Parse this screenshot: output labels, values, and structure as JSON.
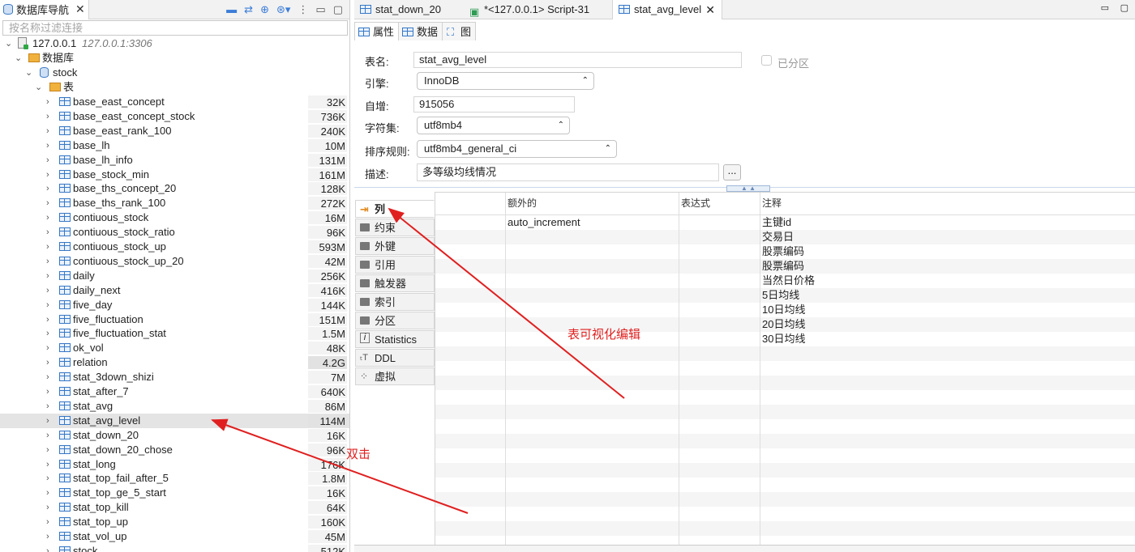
{
  "navigator": {
    "tab_title": "数据库导航",
    "filter_placeholder": "按名称过滤连接",
    "connection": {
      "name": "127.0.0.1",
      "address": "127.0.0.1:3306"
    },
    "databases_folder": "数据库",
    "schema": "stock",
    "tables_folder": "表",
    "tables": [
      {
        "name": "base_east_concept",
        "size": "32K"
      },
      {
        "name": "base_east_concept_stock",
        "size": "736K"
      },
      {
        "name": "base_east_rank_100",
        "size": "240K"
      },
      {
        "name": "base_lh",
        "size": "10M"
      },
      {
        "name": "base_lh_info",
        "size": "131M"
      },
      {
        "name": "base_stock_min",
        "size": "161M"
      },
      {
        "name": "base_ths_concept_20",
        "size": "128K"
      },
      {
        "name": "base_ths_rank_100",
        "size": "272K"
      },
      {
        "name": "contiuous_stock",
        "size": "16M"
      },
      {
        "name": "contiuous_stock_ratio",
        "size": "96K"
      },
      {
        "name": "contiuous_stock_up",
        "size": "593M"
      },
      {
        "name": "contiuous_stock_up_20",
        "size": "42M"
      },
      {
        "name": "daily",
        "size": "256K"
      },
      {
        "name": "daily_next",
        "size": "416K"
      },
      {
        "name": "five_day",
        "size": "144K"
      },
      {
        "name": "five_fluctuation",
        "size": "151M"
      },
      {
        "name": "five_fluctuation_stat",
        "size": "1.5M"
      },
      {
        "name": "ok_vol",
        "size": "48K"
      },
      {
        "name": "relation",
        "size": "4.2G"
      },
      {
        "name": "stat_3down_shizi",
        "size": "7M"
      },
      {
        "name": "stat_after_7",
        "size": "640K"
      },
      {
        "name": "stat_avg",
        "size": "86M"
      },
      {
        "name": "stat_avg_level",
        "size": "114M"
      },
      {
        "name": "stat_down_20",
        "size": "16K"
      },
      {
        "name": "stat_down_20_chose",
        "size": "96K"
      },
      {
        "name": "stat_long",
        "size": "176K"
      },
      {
        "name": "stat_top_fail_after_5",
        "size": "1.8M"
      },
      {
        "name": "stat_top_ge_5_start",
        "size": "16K"
      },
      {
        "name": "stat_top_kill",
        "size": "64K"
      },
      {
        "name": "stat_top_up",
        "size": "160K"
      },
      {
        "name": "stat_vol_up",
        "size": "45M"
      },
      {
        "name": "stock",
        "size": "512K"
      }
    ]
  },
  "editor_tabs": [
    "stat_down_20",
    "*<127.0.0.1> Script-31",
    "stat_avg_level"
  ],
  "sub_tabs": [
    "属性",
    "数据",
    "图"
  ],
  "form": {
    "name_label": "表名:",
    "name_value": "stat_avg_level",
    "partition_label": "已分区",
    "engine_label": "引擎:",
    "engine_value": "InnoDB",
    "auto_inc_label": "自增:",
    "auto_inc_value": "915056",
    "charset_label": "字符集:",
    "charset_value": "utf8mb4",
    "collation_label": "排序规则:",
    "collation_value": "utf8mb4_general_ci",
    "desc_label": "描述:",
    "desc_value": "多等级均线情况",
    "dots": "..."
  },
  "side_tabs": [
    "列",
    "约束",
    "外键",
    "引用",
    "触发器",
    "索引",
    "分区",
    "Statistics",
    "DDL",
    "虚拟"
  ],
  "columns_grid": {
    "headers": [
      "额外的",
      "表达式",
      "注释"
    ],
    "rows": [
      {
        "extra": "auto_increment",
        "comment": "主键id"
      },
      {
        "extra": "",
        "comment": "交易日"
      },
      {
        "extra": "",
        "comment": "股票编码"
      },
      {
        "extra": "",
        "comment": "股票编码"
      },
      {
        "extra": "",
        "comment": "当然日价格"
      },
      {
        "extra": "",
        "comment": "5日均线"
      },
      {
        "extra": "",
        "comment": "10日均线"
      },
      {
        "extra": "",
        "comment": "20日均线"
      },
      {
        "extra": "",
        "comment": "30日均线"
      }
    ]
  },
  "annotations": {
    "double_click": "双击",
    "visual_edit": "表可视化编辑"
  },
  "colors": {
    "accent": "#3677c6",
    "annotation": "#e02020",
    "folder": "#f0b23d"
  }
}
